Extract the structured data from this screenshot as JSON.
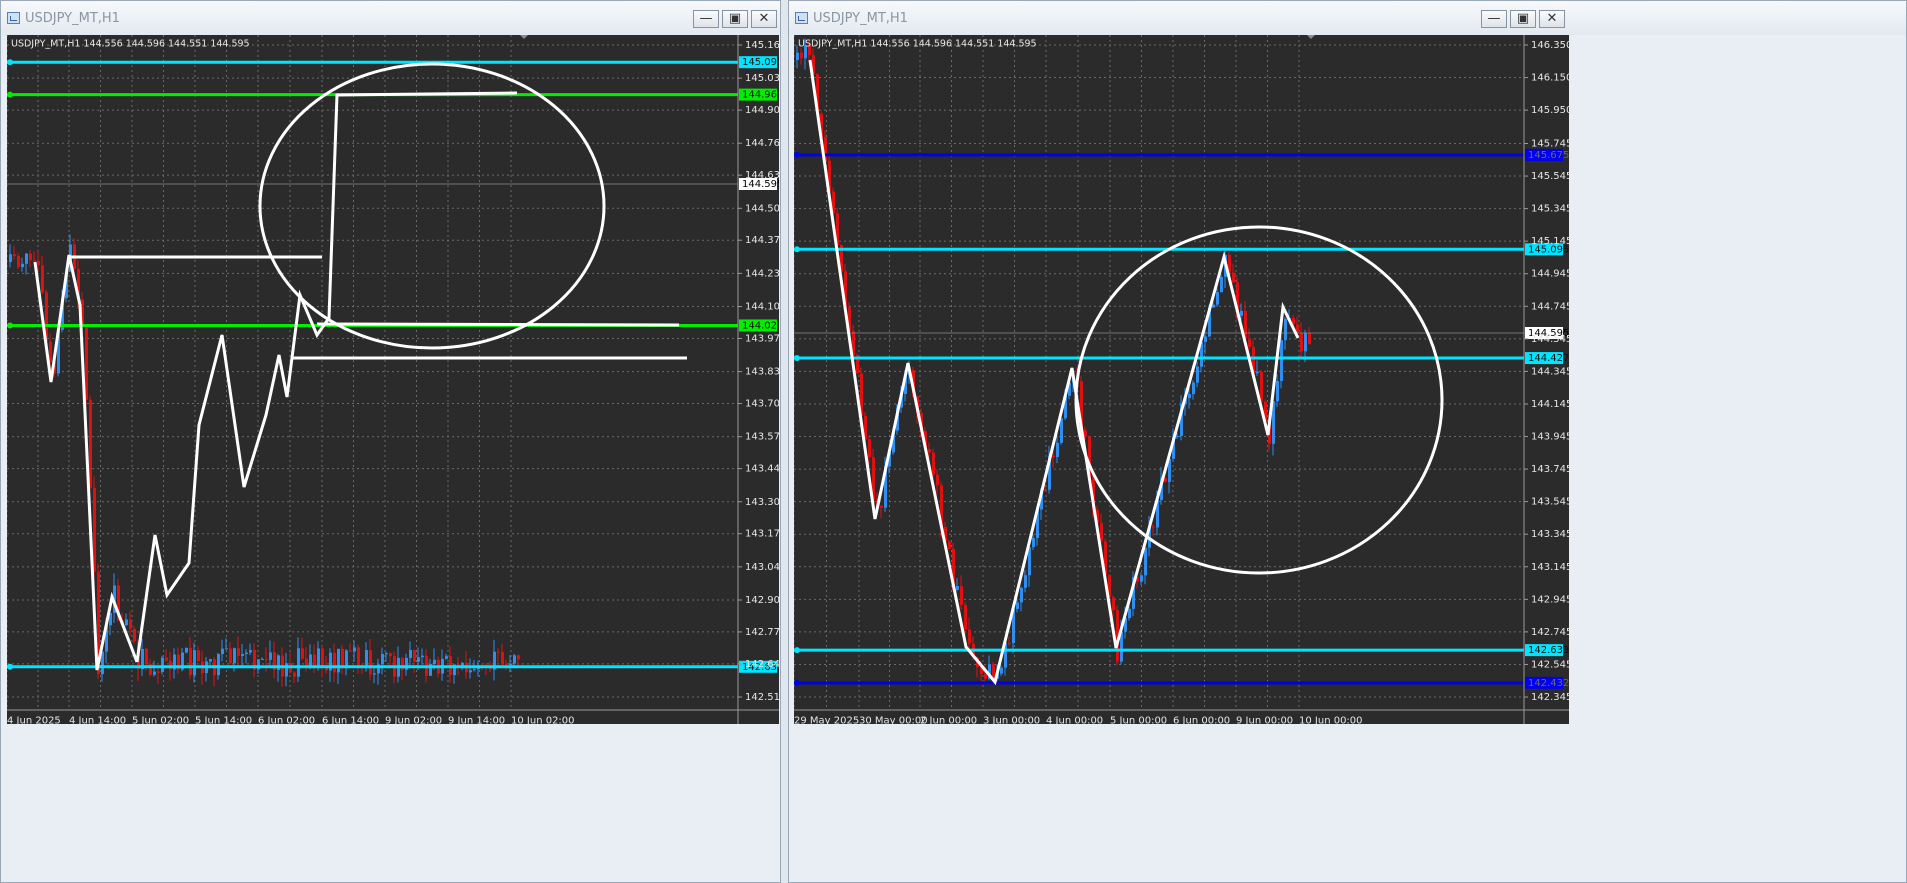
{
  "windows": [
    {
      "title": "USDJPY_MT,H1",
      "header": "USDJPY_MT,H1  144.556 144.596 144.551 144.595",
      "price_labels": [
        "145.165",
        "145.030",
        "144.900",
        "144.765",
        "144.635",
        "144.500",
        "144.370",
        "144.235",
        "144.100",
        "143.970",
        "143.835",
        "143.705",
        "143.570",
        "143.440",
        "143.305",
        "143.175",
        "143.040",
        "142.905",
        "142.775",
        "142.645",
        "142.510"
      ],
      "time_labels": [
        "4 Jun 2025",
        "4 Jun 14:00",
        "5 Jun 02:00",
        "5 Jun 14:00",
        "6 Jun 02:00",
        "6 Jun 14:00",
        "9 Jun 02:00",
        "9 Jun 14:00",
        "10 Jun 02:00"
      ],
      "current_price": "144.595",
      "levels": [
        {
          "value": "145.095",
          "color": "#00e5ff"
        },
        {
          "value": "144.963",
          "color": "#00ee00"
        },
        {
          "value": "144.023",
          "color": "#00ee00"
        },
        {
          "value": "142.633",
          "color": "#00e5ff"
        }
      ]
    },
    {
      "title": "USDJPY_MT,H1",
      "header": "USDJPY_MT,H1  144.556 144.596 144.551 144.595",
      "price_labels": [
        "146.350",
        "146.150",
        "145.950",
        "145.745",
        "145.545",
        "145.345",
        "145.145",
        "144.945",
        "144.745",
        "144.545",
        "144.345",
        "144.145",
        "143.945",
        "143.745",
        "143.545",
        "143.345",
        "143.145",
        "142.945",
        "142.745",
        "142.545",
        "142.345"
      ],
      "time_labels": [
        "29 May 2025",
        "30 May 00:00",
        "2 Jun 00:00",
        "3 Jun 00:00",
        "4 Jun 00:00",
        "5 Jun 00:00",
        "6 Jun 00:00",
        "9 Jun 00:00",
        "10 Jun 00:00"
      ],
      "current_price": "144.595",
      "levels": [
        {
          "value": "145.675",
          "color": "#0000ee"
        },
        {
          "value": "145.095",
          "color": "#00e5ff"
        },
        {
          "value": "144.427",
          "color": "#00e5ff"
        },
        {
          "value": "142.633",
          "color": "#00e5ff"
        },
        {
          "value": "142.432",
          "color": "#0000ee"
        }
      ]
    }
  ],
  "controls": {
    "minimize": "—",
    "maximize": "▣",
    "close": "✕"
  },
  "colors": {
    "bull": "#2f8ef0",
    "bear": "#e01010",
    "grid": "#6a6a6a",
    "annotation": "#ffffff"
  }
}
